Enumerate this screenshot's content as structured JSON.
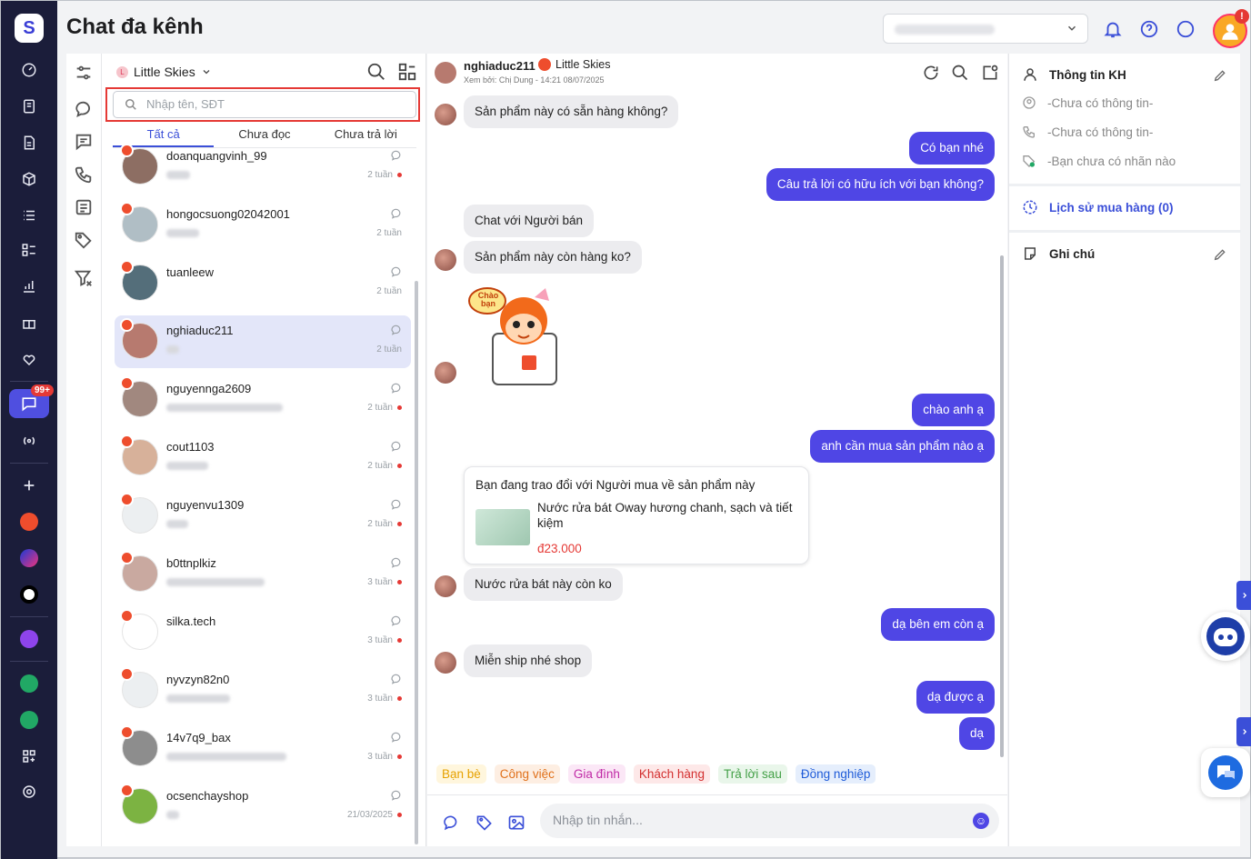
{
  "app": {
    "title": "Chat đa kênh"
  },
  "rail": {
    "chat_badge": "99+"
  },
  "header": {
    "alert_badge": "!"
  },
  "conv_pane": {
    "shop_name": "Little Skies",
    "shop_initial": "L",
    "search_placeholder": "Nhập tên, SĐT",
    "tabs": [
      "Tất cả",
      "Chưa đọc",
      "Chưa trả lời"
    ],
    "conversations": [
      {
        "name": "doanquangvinh_99",
        "time": "2 tuần",
        "unread": true
      },
      {
        "name": "hongocsuong02042001",
        "time": "2 tuần",
        "unread": false
      },
      {
        "name": "tuanleew",
        "time": "2 tuần",
        "unread": false
      },
      {
        "name": "nghiaduc211",
        "time": "2 tuần",
        "unread": false,
        "selected": true
      },
      {
        "name": "nguyennga2609",
        "time": "2 tuần",
        "unread": true
      },
      {
        "name": "cout1103",
        "time": "2 tuần",
        "unread": true
      },
      {
        "name": "nguyenvu1309",
        "time": "2 tuần",
        "unread": true
      },
      {
        "name": "b0ttnplkiz",
        "time": "3 tuần",
        "unread": true
      },
      {
        "name": "silka.tech",
        "time": "3 tuần",
        "unread": true
      },
      {
        "name": "nyvzyn82n0",
        "time": "3 tuần",
        "unread": true
      },
      {
        "name": "14v7q9_bax",
        "time": "3 tuần",
        "unread": true
      },
      {
        "name": "ocsenchayshop",
        "time": "21/03/2025",
        "unread": true
      }
    ]
  },
  "chat": {
    "customer_name": "nghiaduc211",
    "shop_name": "Little Skies",
    "viewed_by": "Xem bởi: Chị Dung - 14:21 08/07/2025",
    "messages": [
      {
        "dir": "in",
        "text": "Sản phẩm này có sẵn hàng không?"
      },
      {
        "dir": "out",
        "text": "Có bạn nhé"
      },
      {
        "dir": "out",
        "text": "Câu trả lời có hữu ích với bạn không?"
      },
      {
        "dir": "in",
        "text": "Chat với Người bán"
      },
      {
        "dir": "in",
        "text": "Sản phẩm này còn hàng ko?"
      },
      {
        "dir": "out",
        "text": "chào anh ạ"
      },
      {
        "dir": "out",
        "text": "anh cần mua sản phẩm nào ạ"
      },
      {
        "dir": "in",
        "text": "Nước rửa bát này còn ko"
      },
      {
        "dir": "out",
        "text": "dạ bên em còn ạ"
      },
      {
        "dir": "in",
        "text": "Miễn ship nhé shop"
      },
      {
        "dir": "out",
        "text": "dạ được ạ"
      },
      {
        "dir": "out",
        "text": "dạ"
      }
    ],
    "sticker_text": "Chào bạn",
    "product_card": {
      "heading": "Bạn đang trao đổi với Người mua về sản phẩm này",
      "product_name": "Nước rửa bát Oway hương chanh, sạch và tiết kiệm",
      "price": "đ23.000"
    },
    "tags": [
      {
        "label": "Bạn bè",
        "color": "#e6a100",
        "bg": "#fff6dd"
      },
      {
        "label": "Công việc",
        "color": "#e0701a",
        "bg": "#fdeee2"
      },
      {
        "label": "Gia đình",
        "color": "#c02aa6",
        "bg": "#fbe7f6"
      },
      {
        "label": "Khách hàng",
        "color": "#d32f2f",
        "bg": "#fde8e8"
      },
      {
        "label": "Trả lời sau",
        "color": "#43a047",
        "bg": "#e9f6ea"
      },
      {
        "label": "Đồng nghiệp",
        "color": "#1e5bd8",
        "bg": "#e5eefc"
      }
    ],
    "composer_placeholder": "Nhập tin nhắn..."
  },
  "info": {
    "customer_info_title": "Thông tin KH",
    "no_info_1": "-Chưa có thông tin-",
    "no_info_2": "-Chưa có thông tin-",
    "no_label": "-Bạn chưa có nhãn nào",
    "purchase_history": "Lịch sử mua hàng (0)",
    "notes_title": "Ghi chú"
  }
}
